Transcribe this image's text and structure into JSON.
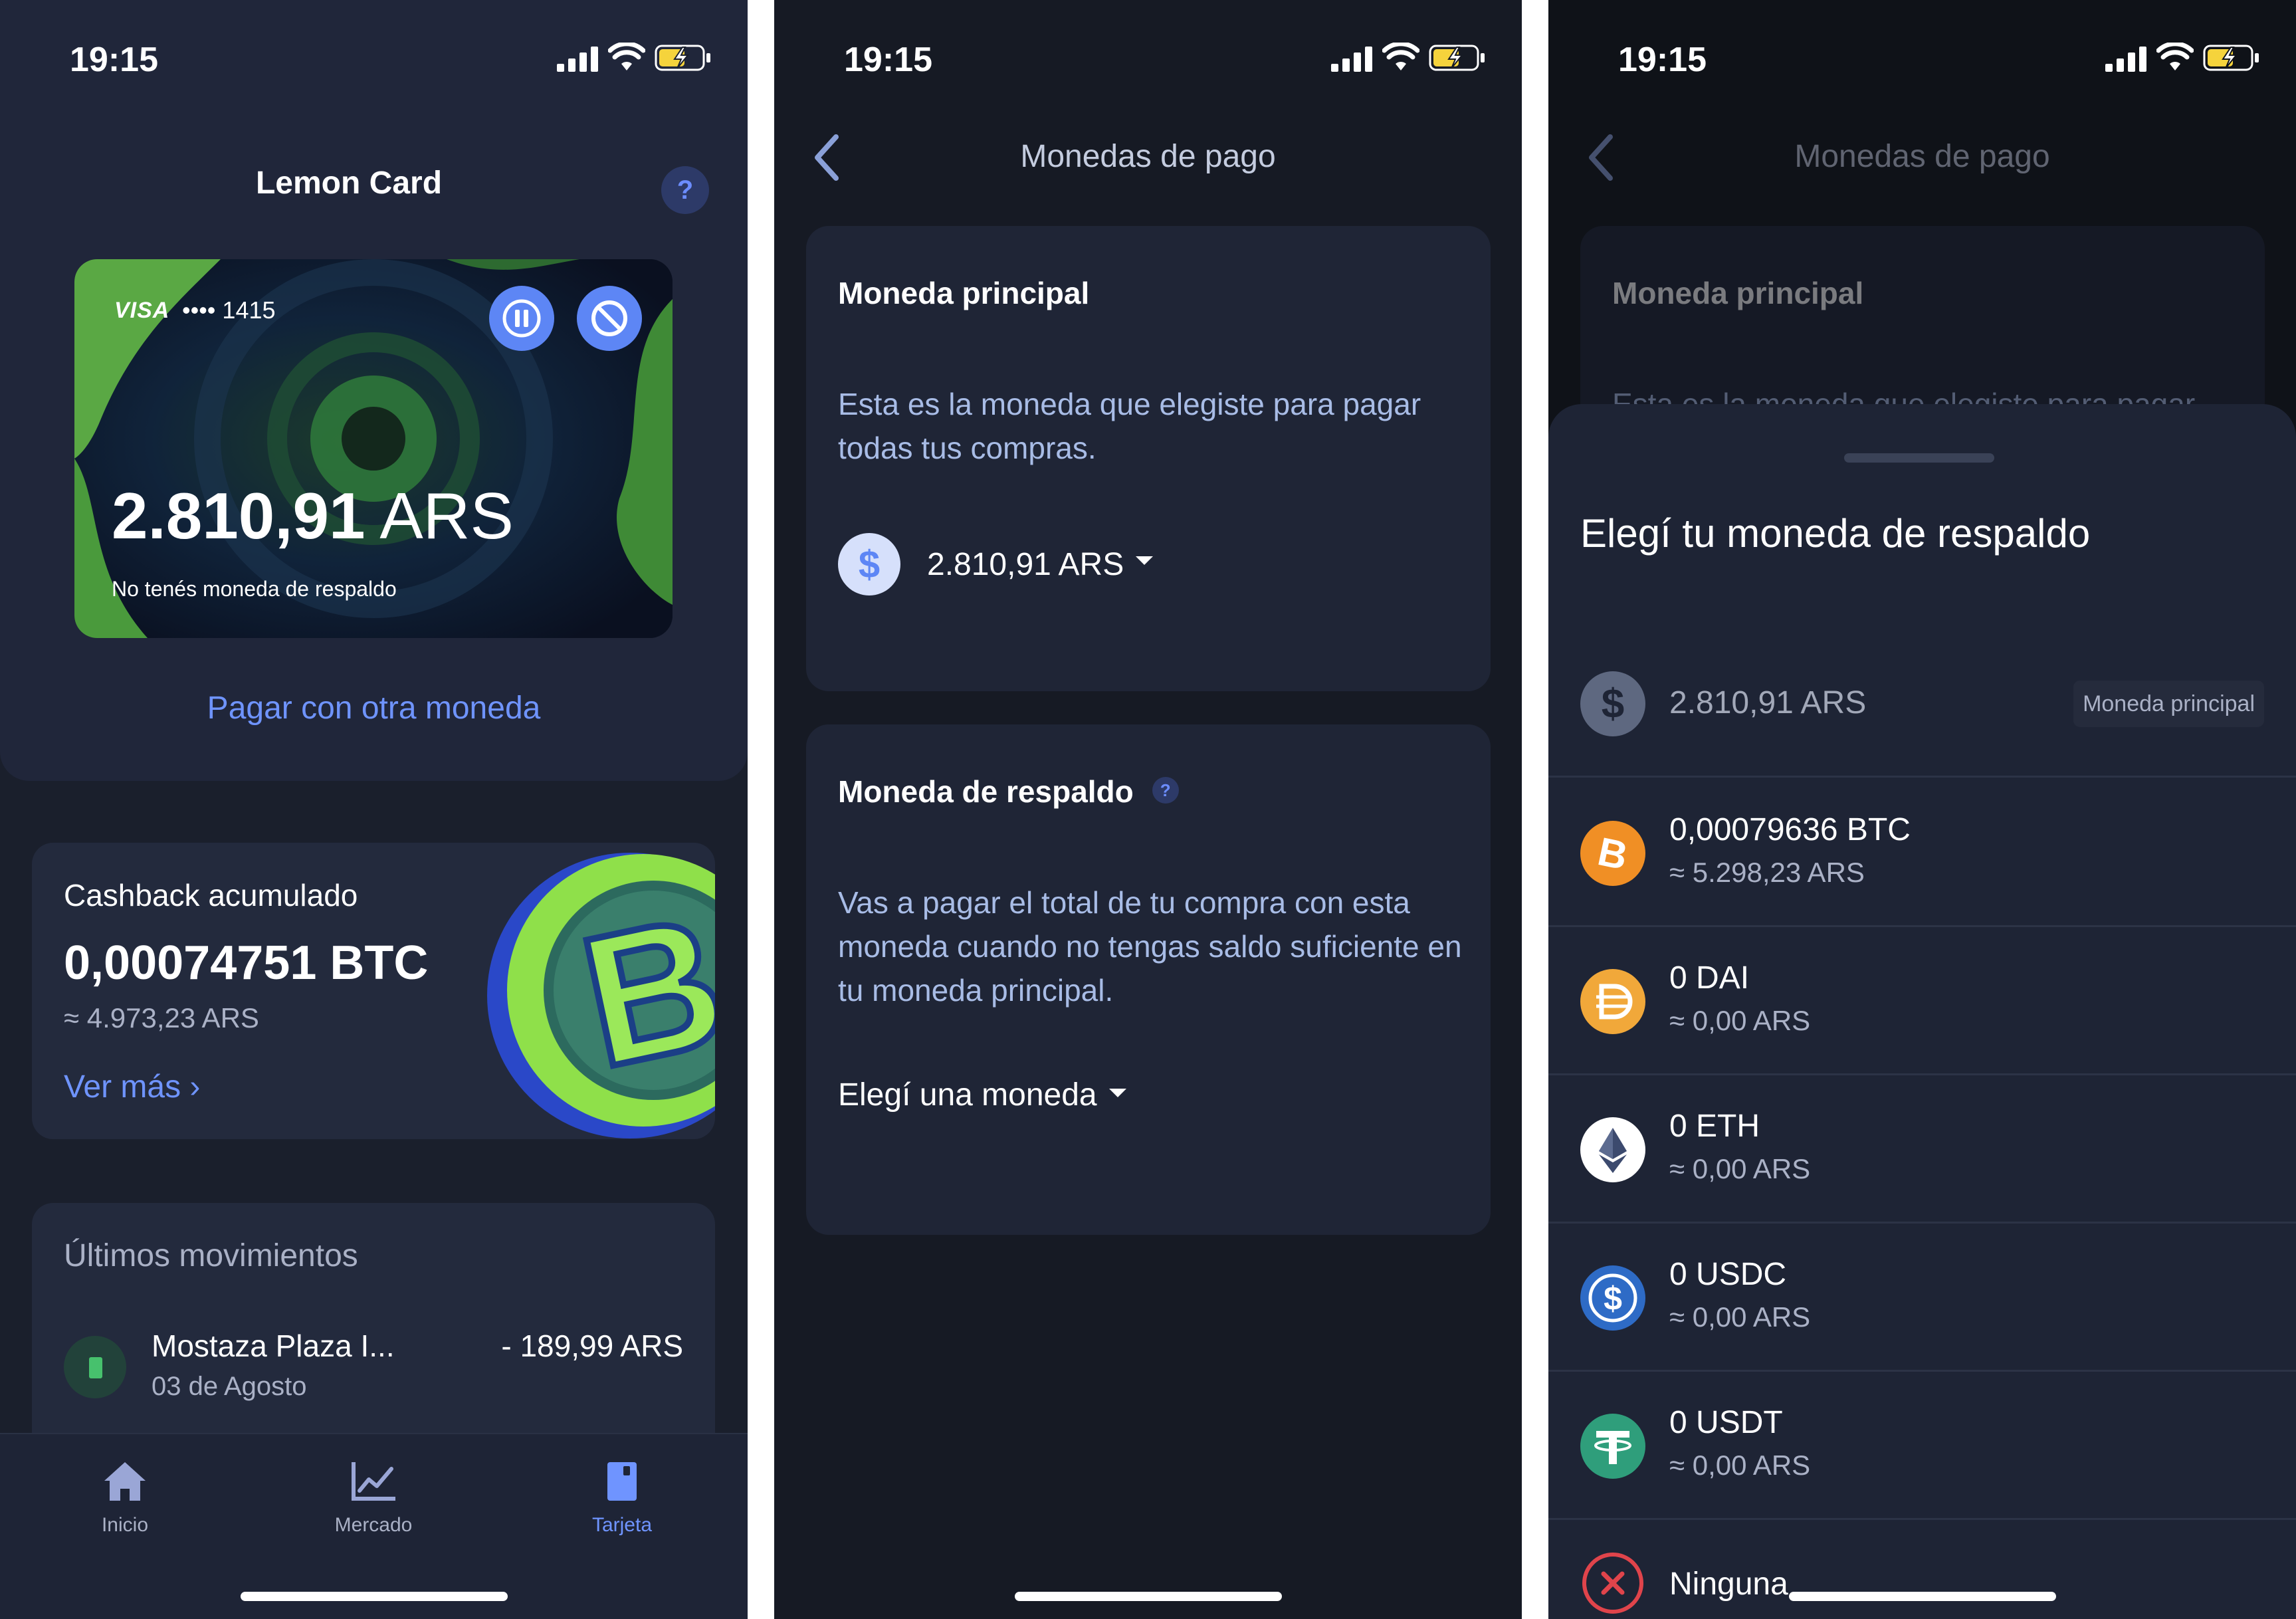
{
  "status": {
    "time": "19:15"
  },
  "screen1": {
    "title": "Lemon Card",
    "help": "?",
    "card": {
      "brand": "VISA",
      "number": "•••• 1415",
      "amount_value": "2.810,91",
      "amount_currency": "ARS",
      "note": "No tenés moneda de respaldo"
    },
    "pay_other": "Pagar con otra moneda",
    "cashback": {
      "label": "Cashback acumulado",
      "amount": "0,00074751 BTC",
      "ars": "≈ 4.973,23 ARS",
      "more": "Ver más ›"
    },
    "movements": {
      "title": "Últimos movimientos",
      "items": [
        {
          "name": "Mostaza Plaza I...",
          "date": "03 de Agosto",
          "amount": "- 189,99 ARS"
        }
      ]
    },
    "tabs": [
      {
        "label": "Inicio",
        "icon": "home-icon"
      },
      {
        "label": "Mercado",
        "icon": "chart-icon"
      },
      {
        "label": "Tarjeta",
        "icon": "card-icon"
      }
    ],
    "active_tab": "Tarjeta"
  },
  "screen2": {
    "nav_title": "Monedas de pago",
    "principal": {
      "title": "Moneda principal",
      "desc": "Esta es la moneda que elegiste para pagar todas tus compras.",
      "coin_symbol": "$",
      "coin_value": "2.810,91 ARS"
    },
    "respaldo": {
      "title": "Moneda de respaldo",
      "help": "?",
      "desc": "Vas a pagar el total de tu compra con esta moneda cuando no tengas saldo suficiente en tu moneda principal.",
      "choose": "Elegí una moneda"
    }
  },
  "screen3": {
    "nav_title": "Monedas de pago",
    "principal_title": "Moneda principal",
    "principal_desc_partial": "Esta es la moneda que elegiste para pagar",
    "sheet": {
      "title": "Elegí tu moneda de respaldo",
      "options": [
        {
          "main": "2.810,91 ARS",
          "sub": "",
          "badge": "Moneda principal",
          "icon": "ars-icon",
          "color": "#6b7590"
        },
        {
          "main": "0,00079636 BTC",
          "sub": "≈ 5.298,23 ARS",
          "badge": "",
          "icon": "bitcoin-icon",
          "color": "#f08f25"
        },
        {
          "main": "0 DAI",
          "sub": "≈ 0,00 ARS",
          "badge": "",
          "icon": "dai-icon",
          "color": "#f1a83a"
        },
        {
          "main": "0 ETH",
          "sub": "≈ 0,00 ARS",
          "badge": "",
          "icon": "ethereum-icon",
          "color": "#ffffff"
        },
        {
          "main": "0 USDC",
          "sub": "≈ 0,00 ARS",
          "badge": "",
          "icon": "usdc-icon",
          "color": "#2e6bc6"
        },
        {
          "main": "0 USDT",
          "sub": "≈ 0,00 ARS",
          "badge": "",
          "icon": "tether-icon",
          "color": "#2f9e7b"
        },
        {
          "main": "Ninguna",
          "sub": "",
          "badge": "",
          "icon": "none-icon",
          "color": "#e0444b"
        }
      ]
    }
  }
}
